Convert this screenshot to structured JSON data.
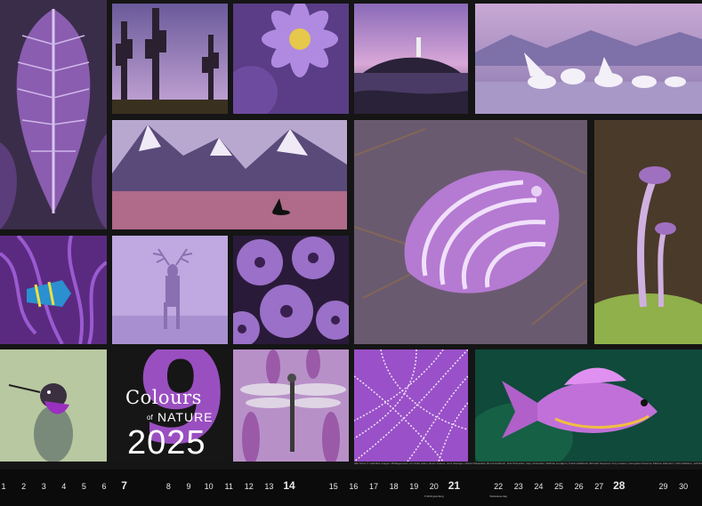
{
  "title": {
    "digit": "9",
    "word_colours": "Colours",
    "word_of": "of",
    "word_nature": "NATURE",
    "year": "2025"
  },
  "tiles": [
    {
      "id": "leaf",
      "subject": "purple-leaf-photo"
    },
    {
      "id": "cactus",
      "subject": "cactus-dusk-photo"
    },
    {
      "id": "aster",
      "subject": "purple-aster-flower-photo"
    },
    {
      "id": "lighthouse",
      "subject": "lighthouse-island-photo"
    },
    {
      "id": "pelicans",
      "subject": "pelicans-lake-photo"
    },
    {
      "id": "mountains",
      "subject": "snowy-mountains-orca-photo"
    },
    {
      "id": "seashell",
      "subject": "purple-seashell-photo"
    },
    {
      "id": "mushroom",
      "subject": "purple-mushrooms-photo"
    },
    {
      "id": "anemone",
      "subject": "fish-in-anemone-photo"
    },
    {
      "id": "deer",
      "subject": "deer-in-fog-photo"
    },
    {
      "id": "urchins",
      "subject": "sea-urchins-photo"
    },
    {
      "id": "hummingbird",
      "subject": "hummingbird-photo"
    },
    {
      "id": "dragonfly",
      "subject": "dragonfly-heather-photo"
    },
    {
      "id": "web",
      "subject": "dewy-spiderweb-photo"
    },
    {
      "id": "fish",
      "subject": "purple-reef-fish-photo"
    }
  ],
  "credits": "Alle Fotos © mauritius images / Bildagenturen von Anke Adam, Erwin Jeanes, Jens Steiniger, Robert Dasselaar, Bernd Hubbuch, Rod Schneider, Gary Schneider, Mathias Lundgren, Frank Hollebeck, Bernard Gayraud, Cory Lawson, Georgette Douwma, Markus Hofmann, Chris Mattison, Jeff Richter, Wild Wonders of Europe",
  "calendar": {
    "days": [
      {
        "label": "1",
        "bold": false
      },
      {
        "label": "2",
        "bold": false
      },
      {
        "label": "3",
        "bold": false
      },
      {
        "label": "4",
        "bold": false
      },
      {
        "label": "5",
        "bold": false
      },
      {
        "label": "6",
        "bold": false
      },
      {
        "label": "7",
        "bold": true
      },
      {
        "label": "8",
        "bold": false
      },
      {
        "label": "9",
        "bold": false
      },
      {
        "label": "10",
        "bold": false
      },
      {
        "label": "11",
        "bold": false
      },
      {
        "label": "12",
        "bold": false
      },
      {
        "label": "13",
        "bold": false
      },
      {
        "label": "14",
        "bold": true
      },
      {
        "label": "15",
        "bold": false
      },
      {
        "label": "16",
        "bold": false
      },
      {
        "label": "17",
        "bold": false
      },
      {
        "label": "18",
        "bold": false
      },
      {
        "label": "19",
        "bold": false
      },
      {
        "label": "20",
        "bold": false
      },
      {
        "label": "21",
        "bold": true
      },
      {
        "label": "22",
        "bold": false
      },
      {
        "label": "23",
        "bold": false
      },
      {
        "label": "24",
        "bold": false
      },
      {
        "label": "25",
        "bold": false
      },
      {
        "label": "26",
        "bold": false
      },
      {
        "label": "27",
        "bold": false
      },
      {
        "label": "28",
        "bold": true
      },
      {
        "label": "29",
        "bold": false
      },
      {
        "label": "30",
        "bold": false
      }
    ],
    "notes": [
      {
        "day": "20",
        "text": "Frühlingsanfang"
      },
      {
        "day": "22",
        "text": "Weltwassertag"
      }
    ]
  }
}
